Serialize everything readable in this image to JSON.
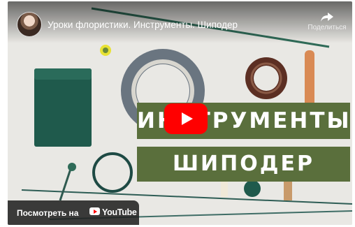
{
  "video": {
    "title": "Уроки флористики. Инструменты. Шиподер",
    "share_label": "Поделиться",
    "banner_line1": "ИНСТРУМЕНТЫ",
    "banner_line2": "ШИПОДЕР",
    "watch_on_label": "Посмотреть на",
    "youtube_wordmark": "YouTube"
  },
  "icons": {
    "channel": "avatar",
    "share": "share-arrow-icon",
    "play": "play-icon",
    "brand": "youtube-logo-icon"
  },
  "colors": {
    "banner": "#5a6f3c",
    "play_button": "#ff0000",
    "foam_block": "#1f5a4c"
  }
}
